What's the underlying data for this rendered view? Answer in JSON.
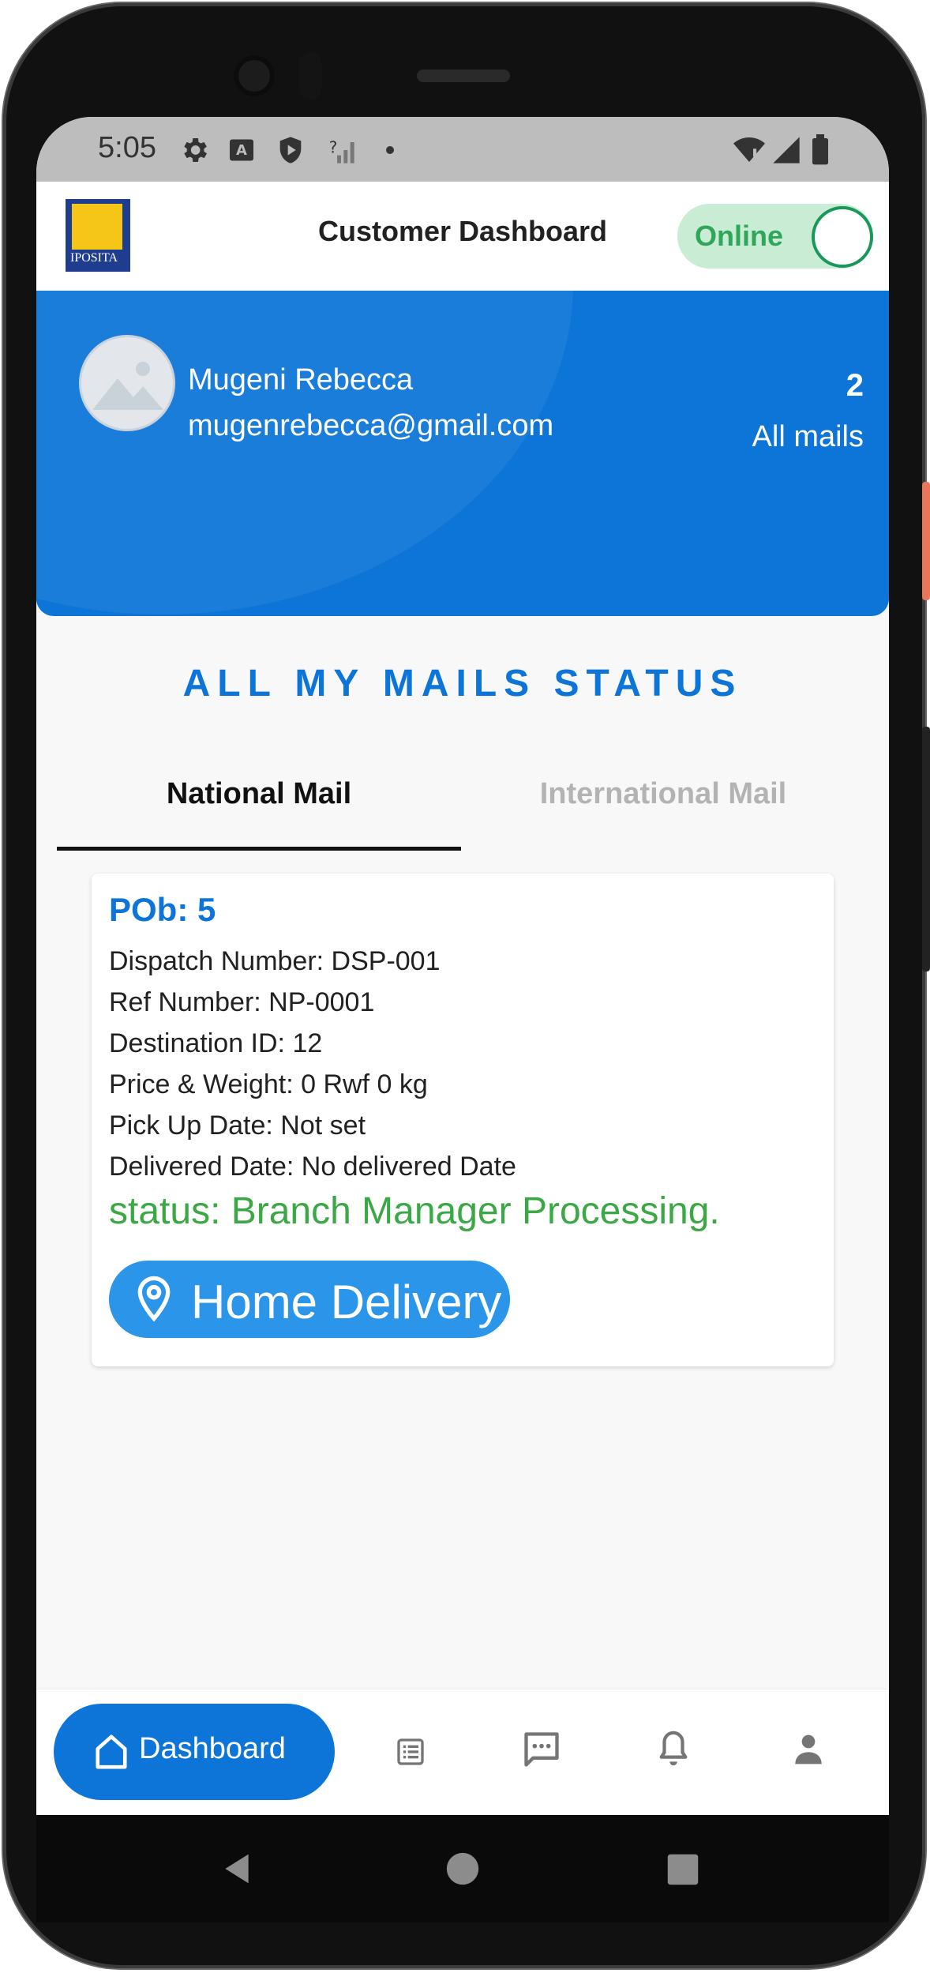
{
  "status_bar": {
    "time": "5:05"
  },
  "app_bar": {
    "logo_text": "IPOSITA",
    "title": "Customer Dashboard",
    "online_label": "Online"
  },
  "profile": {
    "name": "Mugeni Rebecca",
    "email": "mugenrebecca@gmail.com",
    "mail_count": "2",
    "mail_count_label": "All mails"
  },
  "section_title": "ALL MY MAILS STATUS",
  "tabs": [
    {
      "label": "National Mail",
      "active": true
    },
    {
      "label": "International Mail",
      "active": false
    }
  ],
  "mail_card": {
    "pob": "POb: 5",
    "lines": [
      "Dispatch Number: DSP-001",
      "Ref Number: NP-0001",
      "Destination ID: 12",
      "Price & Weight: 0 Rwf 0 kg",
      "Pick Up Date: Not set",
      "Delivered Date: No delivered Date"
    ],
    "status": "status: Branch Manager Processing.",
    "button_label": "Home Delivery"
  },
  "bottom_nav": {
    "dashboard_label": "Dashboard",
    "icons": [
      "home-icon",
      "list-icon",
      "chat-icon",
      "bell-icon",
      "person-icon"
    ]
  },
  "colors": {
    "primary": "#0d75d8",
    "success": "#3ba845",
    "button": "#2b95ea",
    "online_bg": "#c8ecd4"
  }
}
